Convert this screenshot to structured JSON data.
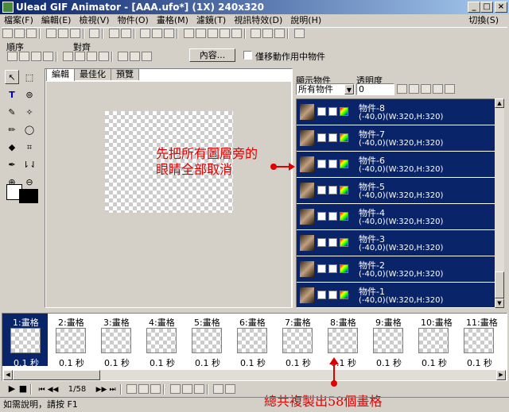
{
  "window": {
    "title": "Ulead GIF Animator - [AAA.ufo*] (1X) 240x320"
  },
  "menu": {
    "items": [
      "檔案(F)",
      "編輯(E)",
      "檢視(V)",
      "物件(O)",
      "畫格(M)",
      "濾鏡(T)",
      "視訊特效(D)",
      "說明(H)"
    ],
    "right": "切換(S)"
  },
  "toolbar2": {
    "order_label": "順序",
    "align_label": "對齊",
    "props_button": "內容...",
    "move_only_label": "僅移動作用中物件"
  },
  "tabs": [
    "編輯",
    "最佳化",
    "預覽"
  ],
  "objects_panel": {
    "show_label": "顯示物件",
    "show_value": "所有物件",
    "opacity_label": "透明度",
    "opacity_value": "0",
    "items": [
      {
        "name": "物件-8",
        "info": "(-40,0)(W:320,H:320)"
      },
      {
        "name": "物件-7",
        "info": "(-40,0)(W:320,H:320)"
      },
      {
        "name": "物件-6",
        "info": "(-40,0)(W:320,H:320)"
      },
      {
        "name": "物件-5",
        "info": "(-40,0)(W:320,H:320)"
      },
      {
        "name": "物件-4",
        "info": "(-40,0)(W:320,H:320)"
      },
      {
        "name": "物件-3",
        "info": "(-40,0)(W:320,H:320)"
      },
      {
        "name": "物件-2",
        "info": "(-40,0)(W:320,H:320)"
      },
      {
        "name": "物件-1",
        "info": "(-40,0)(W:320,H:320)"
      }
    ]
  },
  "annotations": {
    "top_line1": "先把所有圖層旁的",
    "top_line2": "眼睛全部取消",
    "bottom": "總共複製出58個畫格"
  },
  "frames": [
    {
      "label": "1:畫格",
      "time": "0.1 秒"
    },
    {
      "label": "2:畫格",
      "time": "0.1 秒"
    },
    {
      "label": "3:畫格",
      "time": "0.1 秒"
    },
    {
      "label": "4:畫格",
      "time": "0.1 秒"
    },
    {
      "label": "5:畫格",
      "time": "0.1 秒"
    },
    {
      "label": "6:畫格",
      "time": "0.1 秒"
    },
    {
      "label": "7:畫格",
      "time": "0.1 秒"
    },
    {
      "label": "8:畫格",
      "time": "0.1 秒"
    },
    {
      "label": "9:畫格",
      "time": "0.1 秒"
    },
    {
      "label": "10:畫格",
      "time": "0.1 秒"
    },
    {
      "label": "11:畫格",
      "time": "0.1 秒"
    }
  ],
  "player": {
    "frame_counter": "1/58"
  },
  "status": {
    "text": "如需說明，請按 F1"
  }
}
